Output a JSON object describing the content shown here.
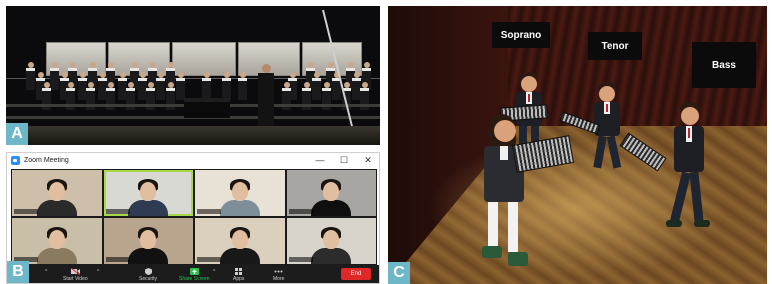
{
  "panels": {
    "a": {
      "label": "A"
    },
    "b": {
      "label": "B"
    },
    "c": {
      "label": "C"
    }
  },
  "zoom": {
    "title": "Zoom Meeting",
    "window_controls": {
      "minimize": "—",
      "maximize": "☐",
      "close": "✕"
    },
    "participants": [
      {
        "bg": "#cdbfa9",
        "shirt": "#2a2a2a",
        "active": false
      },
      {
        "bg": "#d7d9d2",
        "shirt": "#2f3b52",
        "active": true
      },
      {
        "bg": "#e8e2d6",
        "shirt": "#7f8f99",
        "active": false
      },
      {
        "bg": "#a7a6a2",
        "shirt": "#0f0f0f",
        "active": false
      },
      {
        "bg": "#c9bfa8",
        "shirt": "#8a7a5f",
        "active": false
      },
      {
        "bg": "#b9a48d",
        "shirt": "#111111",
        "active": false
      },
      {
        "bg": "#dad0bd",
        "shirt": "#181818",
        "active": false
      },
      {
        "bg": "#d8d4cc",
        "shirt": "#2c2c2c",
        "active": false
      }
    ],
    "toolbar": {
      "mute": "ute",
      "start_video": "Start Video",
      "security": "Security",
      "share_screen": "Share Screen",
      "apps": "Apps",
      "more": "More",
      "end": "End"
    },
    "colors": {
      "accent": "#2d8cff",
      "share_green": "#29c24a",
      "end_red": "#e02828",
      "active_border": "#a6d84a"
    }
  },
  "vr": {
    "signs": {
      "soprano": "Soprano",
      "tenor": "Tenor",
      "bass": "Bass"
    }
  }
}
